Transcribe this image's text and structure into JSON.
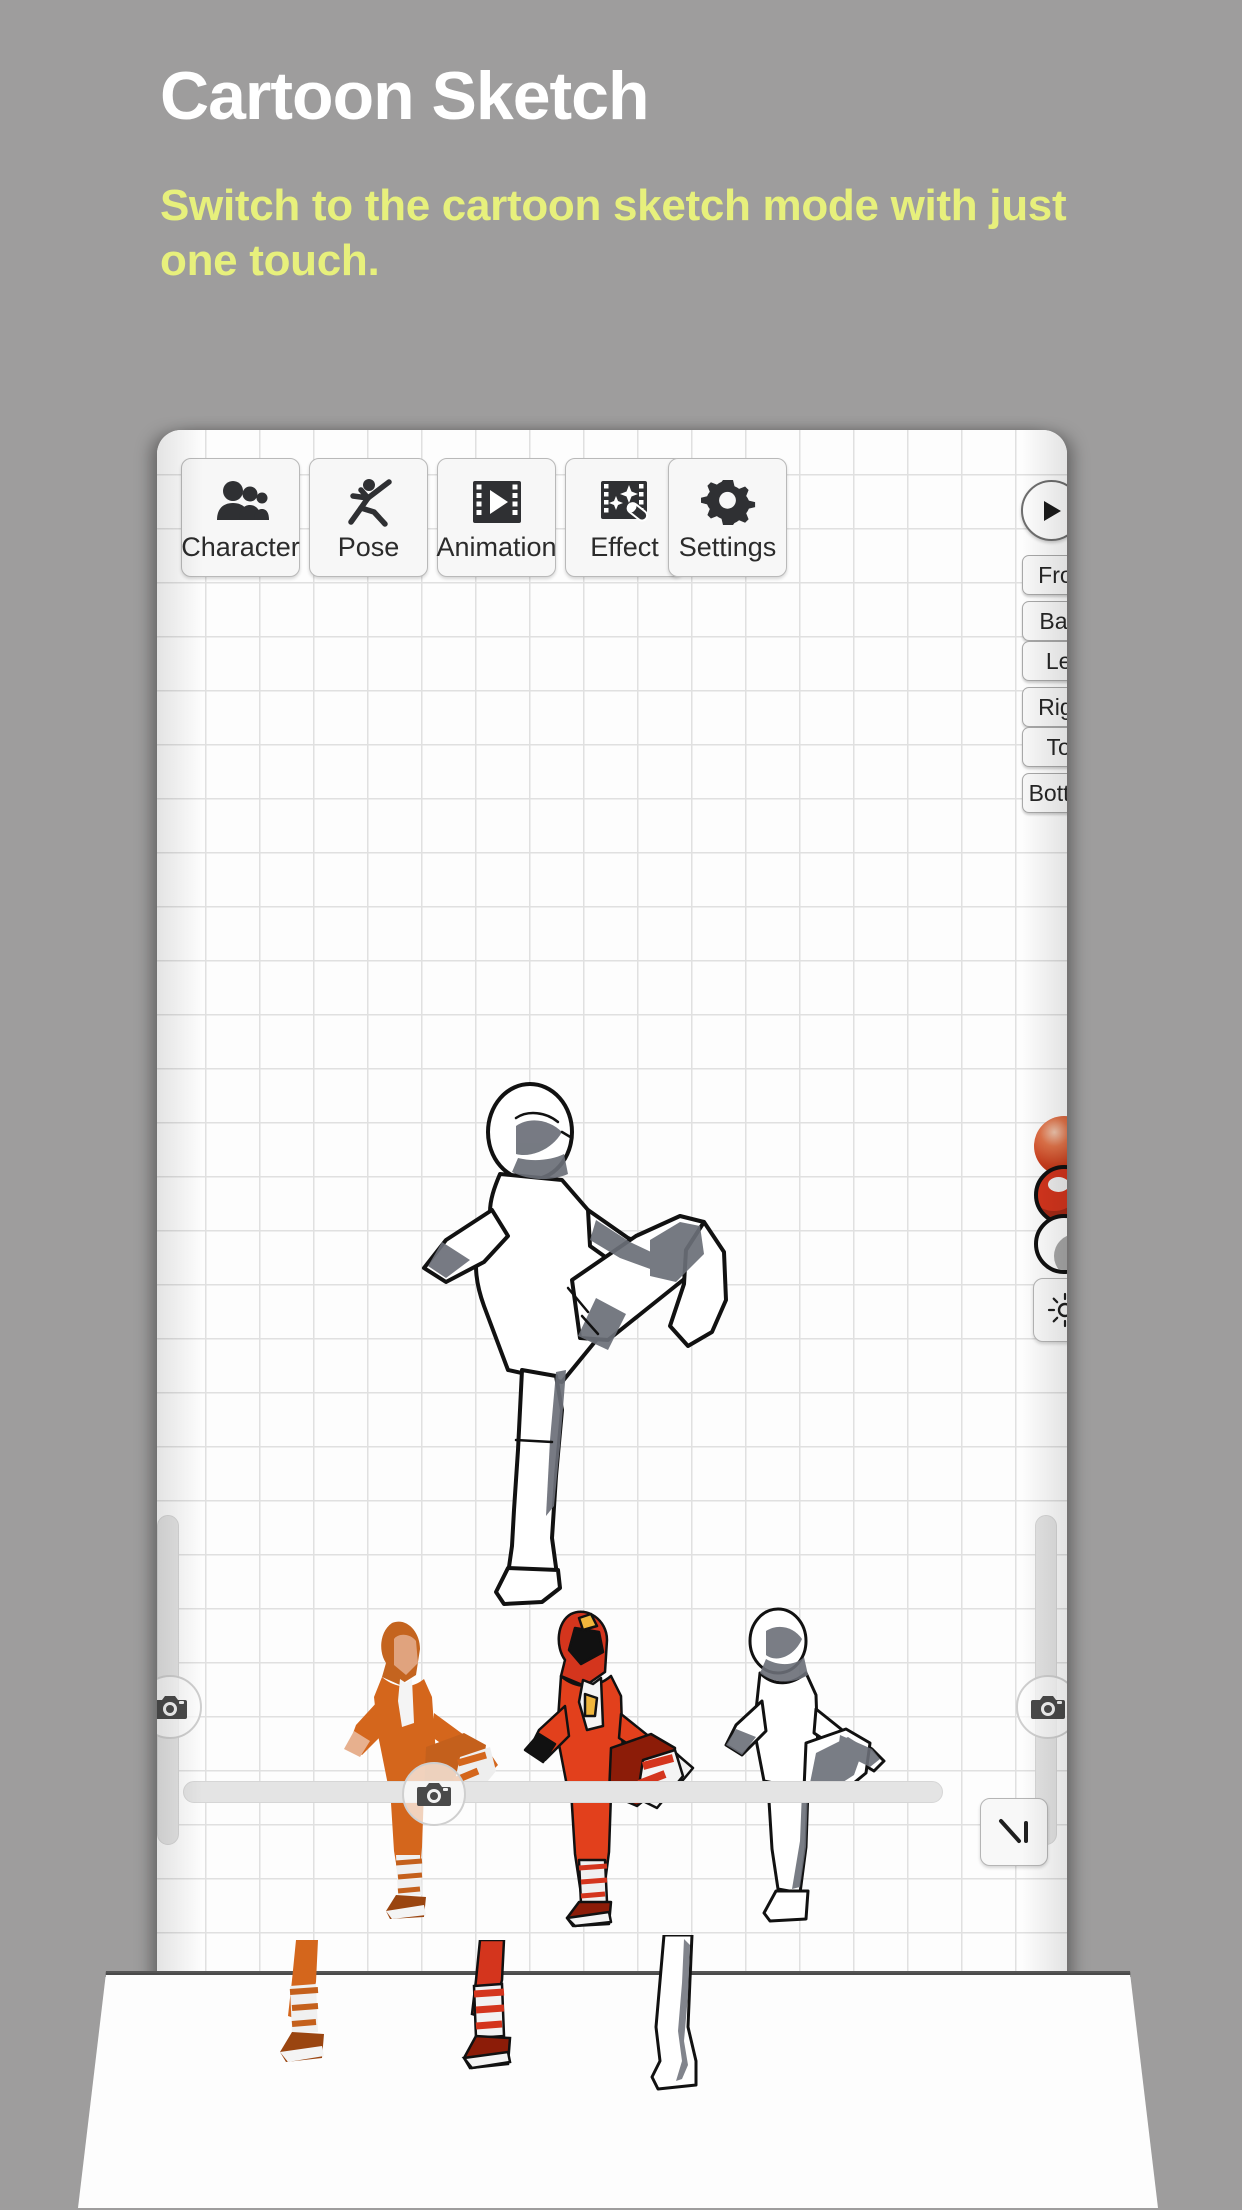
{
  "promo": {
    "title": "Cartoon Sketch",
    "subtitle": "Switch to the cartoon sketch mode with just one touch.",
    "title_color": "#ffffff",
    "subtitle_color": "#e7f07c",
    "background_color": "#9e9d9d"
  },
  "app": {
    "background_color": "#fdfdfd",
    "grid_line_color": "#e0e0e0",
    "toolbar": {
      "items": [
        {
          "label": "Character",
          "icon": "people-icon"
        },
        {
          "label": "Pose",
          "icon": "pose-figure-icon"
        },
        {
          "label": "Animation",
          "icon": "film-play-icon"
        },
        {
          "label": "Effect",
          "icon": "film-sparkle-wand-icon"
        }
      ],
      "settings": {
        "label": "Settings",
        "icon": "gear-icon"
      }
    },
    "playback": {
      "play_icon": "play-icon"
    },
    "view_buttons": [
      {
        "label": "Front"
      },
      {
        "label": "Back"
      },
      {
        "label": "Left"
      },
      {
        "label": "Right"
      },
      {
        "label": "Top"
      },
      {
        "label": "Bottom"
      }
    ],
    "render_modes": [
      {
        "name": "realistic-sphere",
        "selected": false,
        "color": "#c93c1c"
      },
      {
        "name": "cel-shaded-sphere",
        "selected": false,
        "color": "#d4351d"
      },
      {
        "name": "cartoon-sketch-sphere",
        "selected": true,
        "color": "#ffffff"
      }
    ],
    "brightness": {
      "icon": "sun-brightness-icon"
    },
    "sliders": {
      "left": {
        "icon": "camera-icon",
        "value": 58
      },
      "right": {
        "icon": "camera-icon",
        "value": 58
      },
      "bottom": {
        "icon": "camera-icon",
        "value": 33
      }
    },
    "corner_tool": {
      "icon": "measure-tool-icon"
    },
    "viewport": {
      "main_figure": {
        "name": "kicking-pose-figure",
        "style": "cartoon-sketch"
      },
      "thumbnails": [
        {
          "name": "figure-orange-costume",
          "style": "realistic"
        },
        {
          "name": "figure-red-costume",
          "style": "cel-shaded"
        },
        {
          "name": "figure-white-sketch",
          "style": "cartoon-sketch"
        }
      ]
    }
  }
}
